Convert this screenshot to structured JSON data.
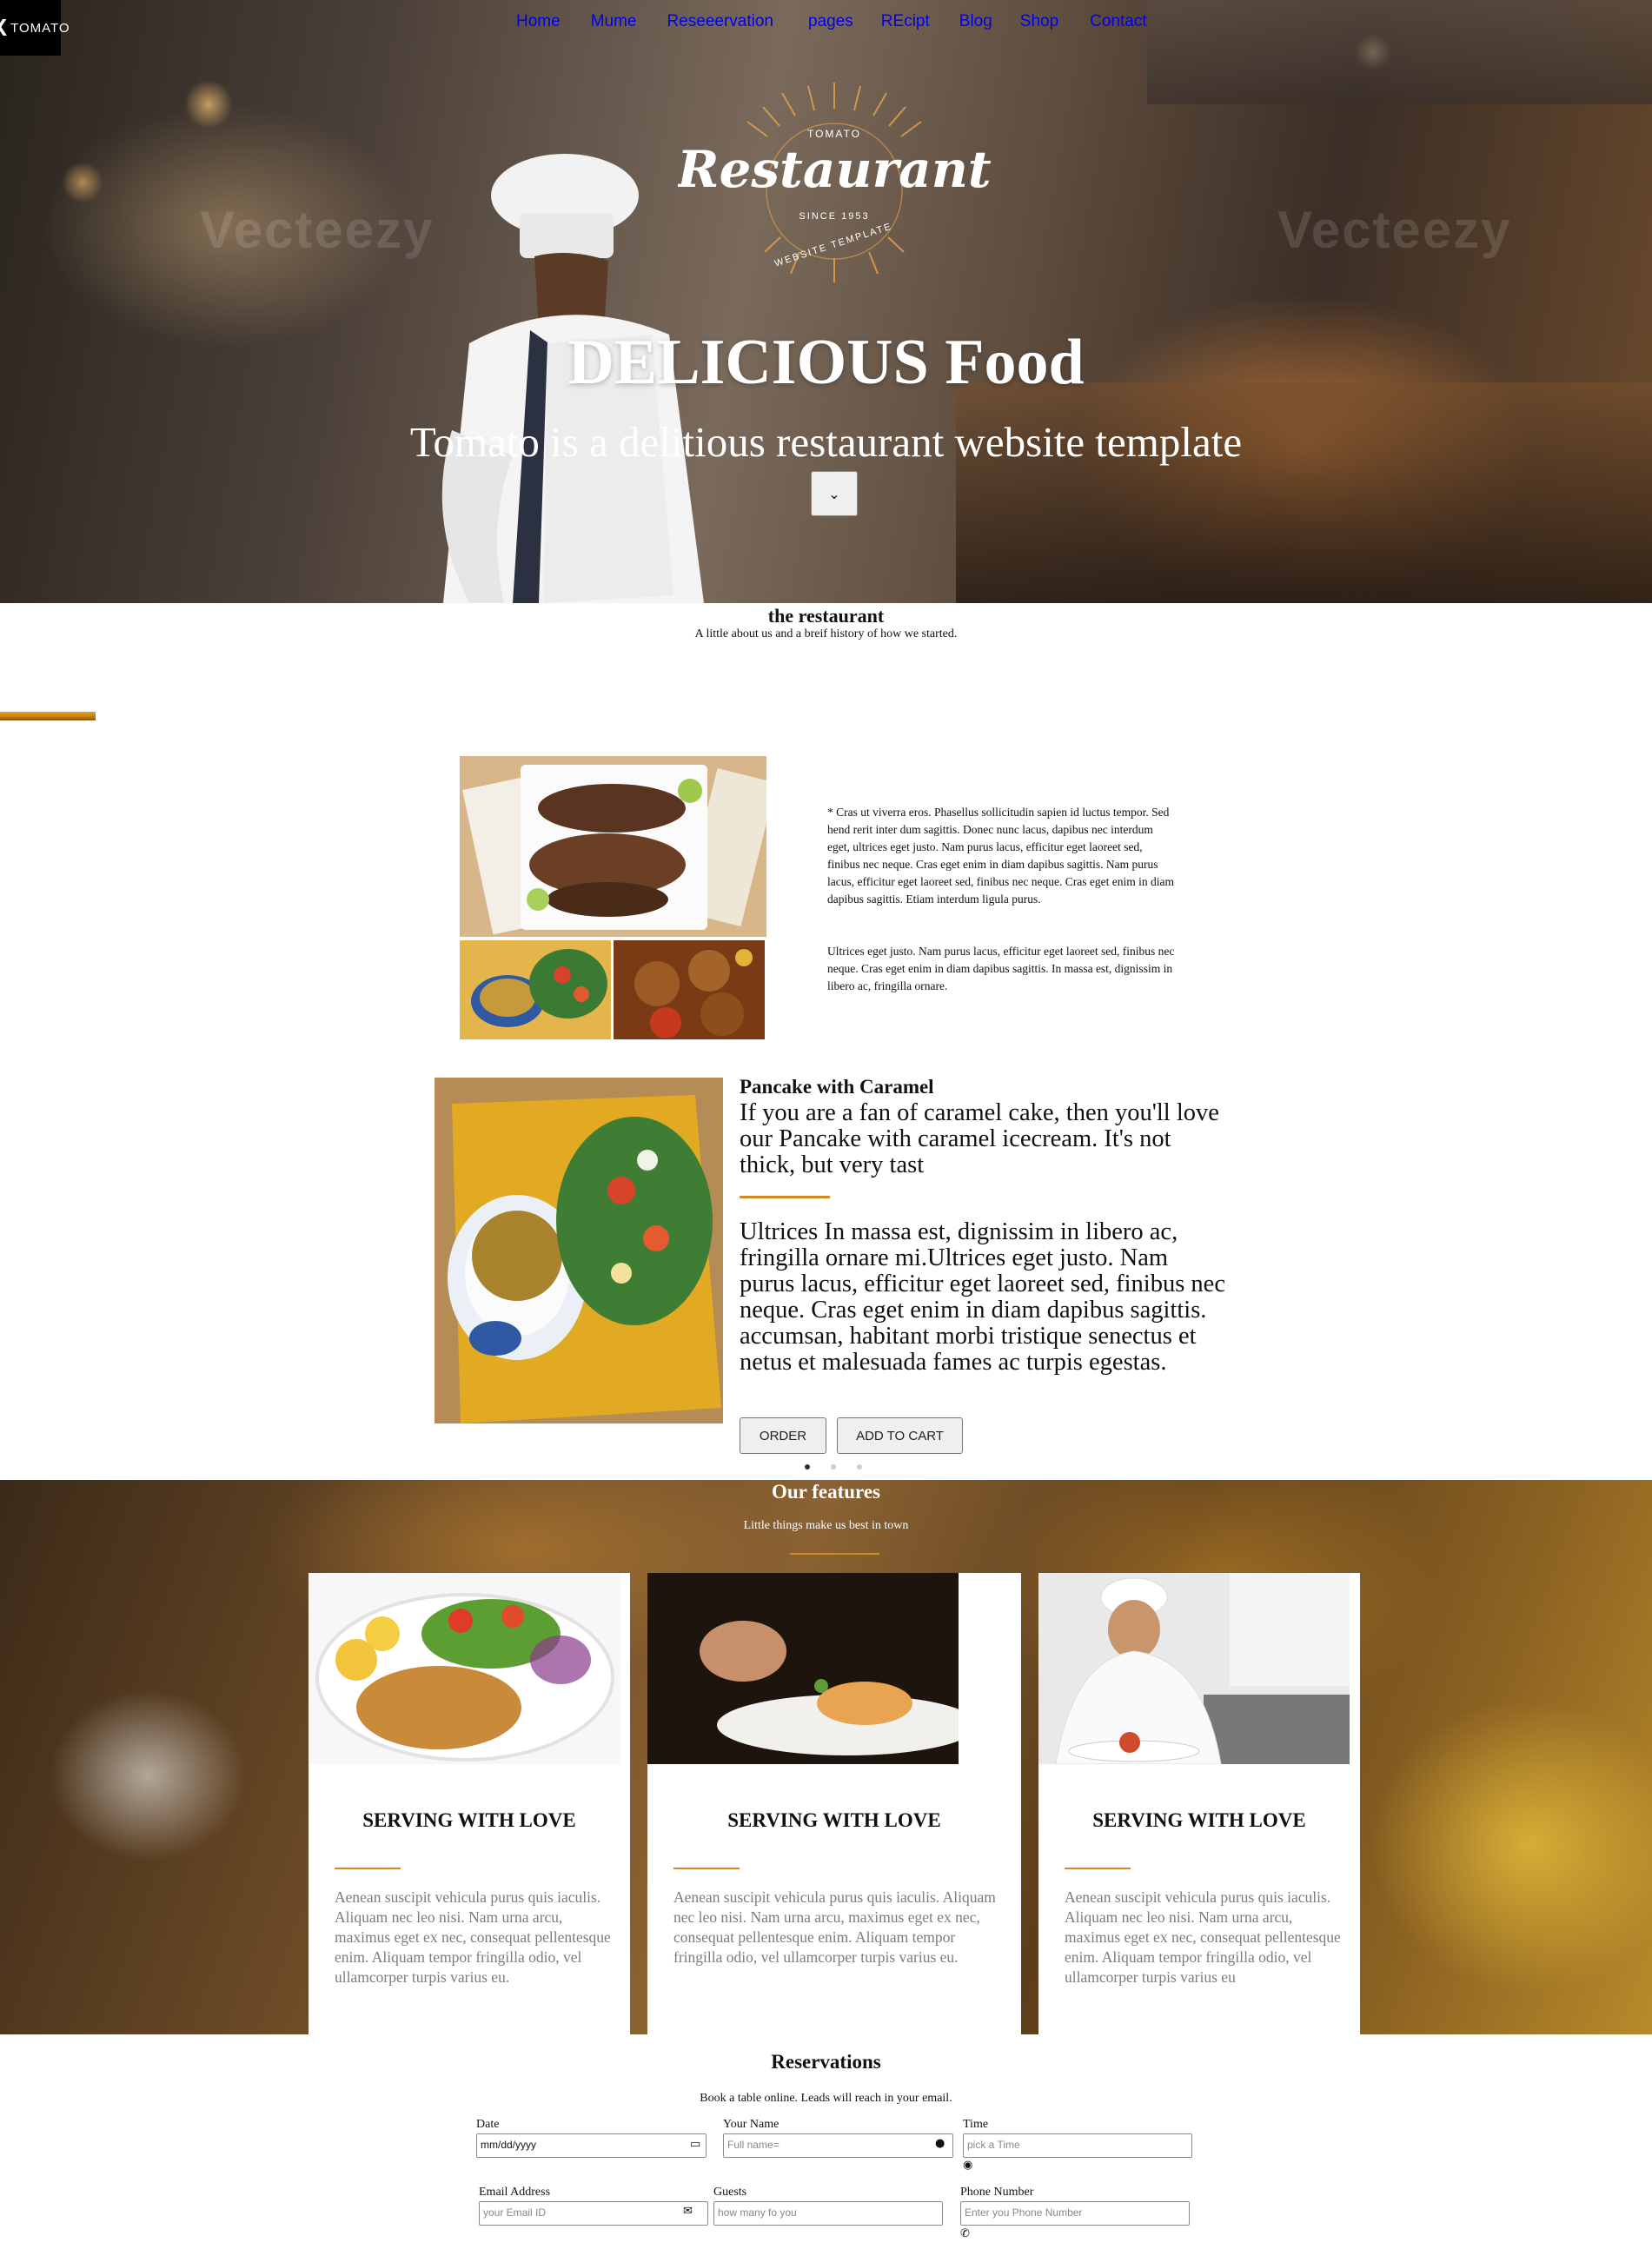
{
  "logo": {
    "mark": "X",
    "name": "TOMATO"
  },
  "nav": [
    "Home",
    "Mume",
    "Reseeervation",
    "pages",
    "REcipt",
    "Blog",
    "Shop",
    "Contact"
  ],
  "emblem": {
    "top": "TOMATO",
    "script": "Restaurant",
    "since": "SINCE 1953",
    "bottom": "WEBSITE TEMPLATE"
  },
  "watermark": "Vecteezy",
  "hero": {
    "title": "DELICIOUS Food",
    "subtitle": "Tomato is a delitious restaurant website template",
    "scroll_icon": "⌄"
  },
  "about": {
    "title": "the restaurant",
    "desc": "A little about us and a breif history of how we started.",
    "para1": "* Cras ut viverra eros. Phasellus sollicitudin sapien id luctus tempor. Sed hend rerit inter dum sagittis. Donec nunc lacus, dapibus nec interdum eget, ultrices eget justo. Nam purus lacus, efficitur eget laoreet sed, finibus nec neque. Cras eget enim in diam dapibus sagittis. Nam purus lacus, efficitur eget laoreet sed, finibus nec neque. Cras eget enim in diam dapibus sagittis. Etiam interdum ligula purus.",
    "para2": "Ultrices eget justo. Nam purus lacus, efficitur eget laoreet sed, finibus nec neque. Cras eget enim in diam dapibus sagittis. In massa est, dignissim in libero ac, fringilla ornare."
  },
  "pancake": {
    "title": "Pancake with Caramel",
    "intro": "If you are a fan of caramel cake, then you'll love our Pancake with caramel icecream. It's not thick, but very tast",
    "body": "Ultrices In massa est, dignissim in libero ac, fringilla ornare mi.Ultrices eget justo. Nam purus lacus, efficitur eget laoreet sed, finibus nec neque. Cras eget enim in diam dapibus sagittis. accumsan, habitant morbi tristique senectus et netus et malesuada fames ac turpis egestas.",
    "order_label": "ORDER",
    "cart_label": "ADD TO CART",
    "slides": 3,
    "active_slide": 1
  },
  "features": {
    "title": "Our features",
    "subtitle": "Little things make us best in town",
    "cards": [
      {
        "title": "SERVING WITH LOVE",
        "text": "Aenean suscipit vehicula purus quis iaculis. Aliquam nec leo nisi. Nam urna arcu, maximus eget ex nec, consequat pellentesque enim. Aliquam tempor fringilla odio, vel ullamcorper turpis varius eu."
      },
      {
        "title": "SERVING WITH LOVE",
        "text": "Aenean suscipit vehicula purus quis iaculis. Aliquam nec leo nisi. Nam urna arcu, maximus eget ex nec, consequat pellentesque enim. Aliquam tempor fringilla odio, vel ullamcorper turpis varius eu."
      },
      {
        "title": "SERVING WITH LOVE",
        "text": "Aenean suscipit vehicula purus quis iaculis. Aliquam nec leo nisi. Nam urna arcu, maximus eget ex nec, consequat pellentesque enim. Aliquam tempor fringilla odio, vel ullamcorper turpis varius eu"
      }
    ]
  },
  "reservation": {
    "title": "Reservations",
    "subtitle": "Book a table online. Leads will reach in your email.",
    "date_label": "Date",
    "date_value": "mm/dd/yyyy",
    "name_label": "Your Name",
    "name_placeholder": "Full name=",
    "time_label": "Time",
    "time_placeholder": "pick a Time",
    "email_label": "Email Address",
    "email_placeholder": "your Email ID",
    "guests_label": "Guests",
    "guests_placeholder": "how many fo you",
    "phone_label": "Phone Number",
    "phone_placeholder": "Enter you Phone Number"
  },
  "colors": {
    "accent": "#d28a1e",
    "link": "#0000ee",
    "muted_text": "#7c7c7c"
  }
}
